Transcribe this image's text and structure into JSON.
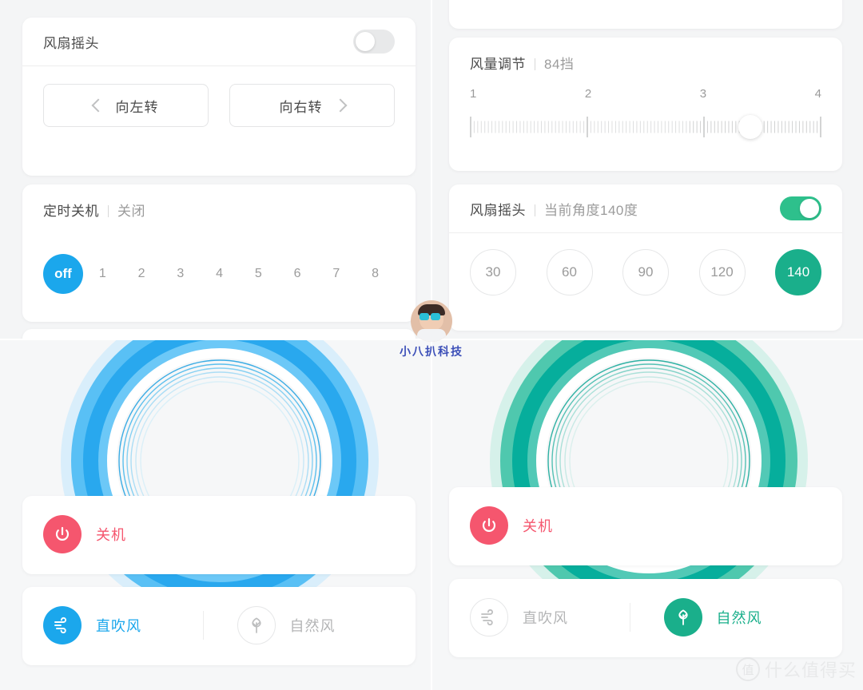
{
  "app": {
    "theme_blue": "#1ba7ec",
    "theme_green": "#1aaf8b",
    "power_red": "#f5566e",
    "muted_gray": "#9b9b9b"
  },
  "panel_top_left": {
    "oscillation_card": {
      "title": "风扇摇头",
      "toggle_state": "off",
      "rotate_left": "向左转",
      "rotate_right": "向右转",
      "left_icon": "chevron-left-icon",
      "right_icon": "chevron-right-icon"
    },
    "timer_card": {
      "title": "定时关机",
      "separator": "|",
      "value": "关闭",
      "options": [
        "off",
        "1",
        "2",
        "3",
        "4",
        "5",
        "6",
        "7",
        "8"
      ],
      "selected": "off"
    }
  },
  "panel_top_right": {
    "airflow_card": {
      "title": "风量调节",
      "separator": "|",
      "value": "84挡",
      "scale_labels": [
        "1",
        "2",
        "3",
        "4"
      ],
      "thumb_percent": 80,
      "total_steps": 100,
      "current_step": 84
    },
    "oscillation_card": {
      "title": "风扇摇头",
      "separator": "|",
      "value": "当前角度140度",
      "toggle_state": "on",
      "angles": [
        "30",
        "60",
        "90",
        "120",
        "140"
      ],
      "selected_angle": "140"
    }
  },
  "panel_bottom_left": {
    "ring_color": "#1ba7ec",
    "power_card": {
      "icon": "power-icon",
      "label": "关机"
    },
    "mode_card": {
      "modes": [
        {
          "icon": "wind-icon",
          "label": "直吹风",
          "active": true
        },
        {
          "icon": "leaf-icon",
          "label": "自然风",
          "active": false
        }
      ]
    }
  },
  "panel_bottom_right": {
    "ring_color": "#1aaf8b",
    "power_card": {
      "icon": "power-icon",
      "label": "关机"
    },
    "mode_card": {
      "modes": [
        {
          "icon": "wind-icon",
          "label": "直吹风",
          "active": false
        },
        {
          "icon": "leaf-icon",
          "label": "自然风",
          "active": true
        }
      ]
    }
  },
  "watermarks": {
    "center": "小八扒科技",
    "bottom_right_badge": "值",
    "bottom_right_text": "什么值得买"
  }
}
